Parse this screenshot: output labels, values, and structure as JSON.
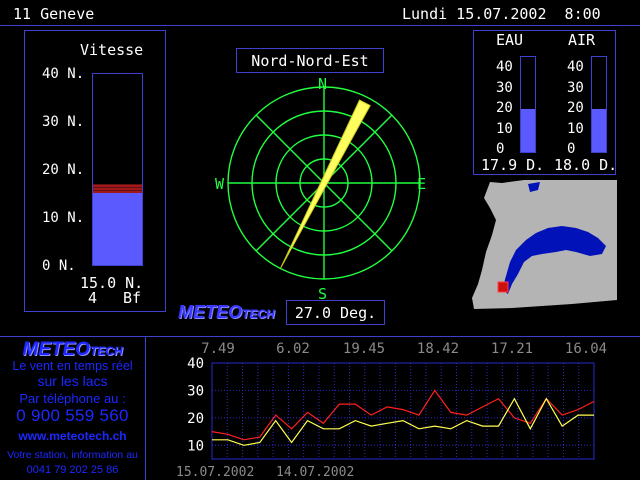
{
  "header": {
    "station": "11 Geneve",
    "datetime": "Lundi 15.07.2002  8:00"
  },
  "speed_panel": {
    "title": "Vitesse",
    "axis_labels": [
      "40 N.",
      "30 N.",
      "20 N.",
      "10 N.",
      "0 N."
    ],
    "value_text": "15.0 N.",
    "beaufort_num": "4",
    "beaufort_unit": "Bf",
    "value": 15.0,
    "gust": 17.0,
    "max": 40
  },
  "compass": {
    "direction_label": "Nord-Nord-Est",
    "cardinals": {
      "n": "N",
      "e": "E",
      "s": "S",
      "w": "W"
    },
    "degrees_text": "27.0 Deg.",
    "degrees": 27.0
  },
  "temperatures": {
    "water": {
      "label": "EAU",
      "value_text": "17.9 D.",
      "value": 17.9
    },
    "air": {
      "label": "AIR",
      "value_text": "18.0 D.",
      "value": 18.0
    },
    "axis_labels": [
      "40",
      "30",
      "20",
      "10",
      "0"
    ],
    "max": 40
  },
  "branding": {
    "logo_main": "METEO",
    "logo_sub": "TECH"
  },
  "ad": {
    "logo_main": "METEO",
    "logo_sub": "TECH",
    "line1": "Le vent en temps réel",
    "line2": "sur les lacs",
    "line3": "Par téléphone au :",
    "phone": "0 900 559 560",
    "website": "www.meteotech.ch",
    "line4": "Votre station, information au",
    "phone2": "0041 79 202 25 86"
  },
  "history": {
    "time_labels": [
      "7.49",
      "6.02",
      "19.45",
      "18.42",
      "17.21",
      "16.04"
    ],
    "date_labels": [
      "15.07.2002",
      "14.07.2002"
    ],
    "y_labels": [
      "40",
      "30",
      "20",
      "10"
    ]
  },
  "chart_data": {
    "type": "line",
    "ylim": [
      5,
      40
    ],
    "series": [
      {
        "values": [
          15,
          14,
          12,
          13,
          21,
          16,
          22,
          18,
          25,
          25,
          21,
          24,
          23,
          21,
          30,
          22,
          21,
          24,
          27,
          20,
          18,
          27,
          21,
          23,
          26
        ]
      },
      {
        "values": [
          12,
          12,
          10,
          11,
          19,
          11,
          19,
          16,
          16,
          19,
          17,
          18,
          19,
          16,
          17,
          16,
          19,
          17,
          17,
          27,
          16,
          27,
          17,
          21,
          21
        ]
      }
    ],
    "colors": [
      "#ff2020",
      "#ffff50"
    ]
  },
  "colors": {
    "frame": "#3f3fd0",
    "bar": "#5a5aff",
    "gust": "#a01818",
    "compass": "#20ff40",
    "arrow": "#ffff60",
    "map_land": "#b4b4b4",
    "map_lake": "#0012b8",
    "station": "#cc1010"
  }
}
